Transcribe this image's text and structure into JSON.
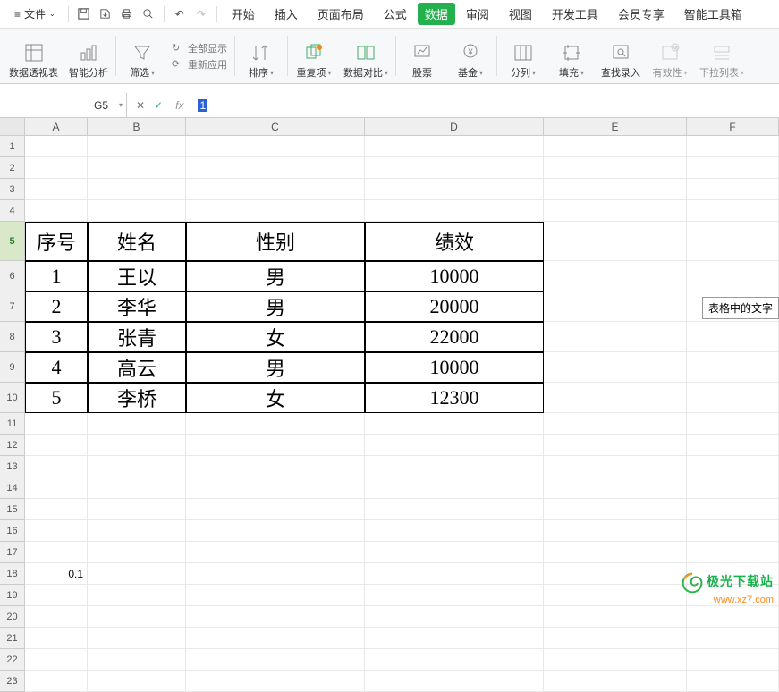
{
  "menu": {
    "file": "文件",
    "tabs": [
      "开始",
      "插入",
      "页面布局",
      "公式",
      "数据",
      "审阅",
      "视图",
      "开发工具",
      "会员专享",
      "智能工具箱"
    ],
    "active_tab": "数据"
  },
  "ribbon": {
    "pivot": "数据透视表",
    "smart": "智能分析",
    "filter": "筛选",
    "show_all": "全部显示",
    "reapply": "重新应用",
    "sort": "排序",
    "dup": "重复项",
    "compare": "数据对比",
    "stock": "股票",
    "fund": "基金",
    "split": "分列",
    "fill": "填充",
    "find_enter": "查找录入",
    "validity": "有效性",
    "dropdown": "下拉列表"
  },
  "namebox": "G5",
  "formula_value": "1",
  "columns": [
    "A",
    "B",
    "C",
    "D",
    "E",
    "F"
  ],
  "row_numbers": [
    1,
    2,
    3,
    4,
    5,
    6,
    7,
    8,
    9,
    10,
    11,
    12,
    13,
    14,
    15,
    16,
    17,
    18,
    19,
    20,
    21,
    22,
    23
  ],
  "table": {
    "headers": [
      "序号",
      "姓名",
      "性别",
      "绩效"
    ],
    "rows": [
      [
        "1",
        "王以",
        "男",
        "10000"
      ],
      [
        "2",
        "李华",
        "男",
        "20000"
      ],
      [
        "3",
        "张青",
        "女",
        "22000"
      ],
      [
        "4",
        "高云",
        "男",
        "10000"
      ],
      [
        "5",
        "李桥",
        "女",
        "12300"
      ]
    ]
  },
  "stray": {
    "a18": "0.1"
  },
  "side_note": "表格中的文字",
  "watermark": {
    "name": "极光下载站",
    "url": "www.xz7.com"
  }
}
